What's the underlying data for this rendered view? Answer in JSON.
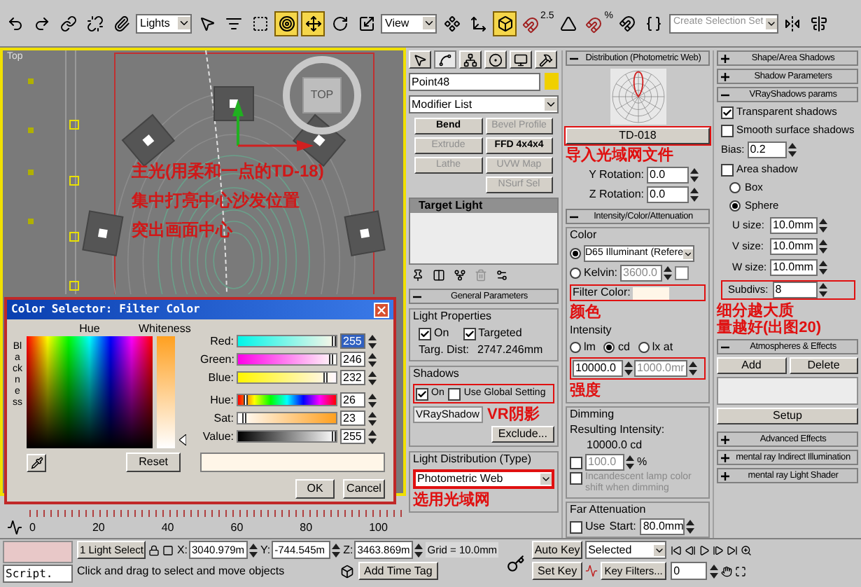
{
  "toolbar": {
    "items": [
      {
        "kind": "icon",
        "selected": false
      },
      {
        "kind": "icon",
        "selected": false
      },
      {
        "kind": "icon",
        "selected": false
      },
      {
        "kind": "icon",
        "selected": false
      },
      {
        "kind": "icon",
        "selected": false
      },
      {
        "kind": "dropdown",
        "value": "Lights"
      },
      {
        "kind": "icon",
        "selected": false
      },
      {
        "kind": "icon",
        "selected": false
      },
      {
        "kind": "icon",
        "selected": false
      },
      {
        "kind": "icon",
        "selected": true
      },
      {
        "kind": "icon",
        "selected": true
      },
      {
        "kind": "icon",
        "selected": false
      },
      {
        "kind": "icon",
        "selected": false
      },
      {
        "kind": "dropdown",
        "value": "View"
      },
      {
        "kind": "icon",
        "selected": false
      },
      {
        "kind": "icon",
        "selected": false
      },
      {
        "kind": "icon",
        "selected": true
      },
      {
        "kind": "snap",
        "label": "2.5",
        "selected": false
      },
      {
        "kind": "icon",
        "selected": false
      },
      {
        "kind": "snap",
        "label": "%",
        "selected": false
      },
      {
        "kind": "icon",
        "selected": false
      },
      {
        "kind": "icon",
        "selected": false
      },
      {
        "kind": "selection_set",
        "placeholder": "Create Selection Set"
      },
      {
        "kind": "icon",
        "selected": false
      },
      {
        "kind": "icon",
        "selected": false
      }
    ]
  },
  "viewport": {
    "label": "Top",
    "view_cube": "TOP",
    "annotation": [
      "主光(用柔和一点的TD-18)",
      "集中打亮中心沙发位置",
      "突出画面中心"
    ]
  },
  "color_selector": {
    "title": "Color Selector: Filter Color",
    "hue_label": "Hue",
    "whiteness_label": "Whiteness",
    "blackness_label": "Blackness",
    "channels": [
      {
        "name": "Red:",
        "value": "255",
        "level": 1.0,
        "selected": true
      },
      {
        "name": "Green:",
        "value": "246",
        "level": 0.965,
        "selected": false
      },
      {
        "name": "Blue:",
        "value": "232",
        "level": 0.91,
        "selected": false
      },
      {
        "name": "Hue:",
        "value": "26",
        "level": 0.1,
        "selected": false
      },
      {
        "name": "Sat:",
        "value": "23",
        "level": 0.09,
        "selected": false
      },
      {
        "name": "Value:",
        "value": "255",
        "level": 1.0,
        "selected": false
      }
    ],
    "reset": "Reset",
    "ok": "OK",
    "cancel": "Cancel"
  },
  "timeline": {
    "ticks": [
      "0",
      "20",
      "40",
      "60",
      "80",
      "100"
    ]
  },
  "command_tabs": [
    {
      "selected": false
    },
    {
      "selected": true
    },
    {
      "selected": false
    },
    {
      "selected": false
    },
    {
      "selected": false
    },
    {
      "selected": false
    }
  ],
  "modify": {
    "object_name": "Point48",
    "modifier_list": "Modifier List",
    "modifier_buttons": [
      {
        "label": "Bend",
        "disabled": false
      },
      {
        "label": "Bevel Profile",
        "disabled": true
      },
      {
        "label": "Extrude",
        "disabled": true
      },
      {
        "label": "FFD 4x4x4",
        "disabled": false
      },
      {
        "label": "Lathe",
        "disabled": true
      },
      {
        "label": "UVW Map",
        "disabled": true
      },
      {
        "label": "NSurf Sel",
        "disabled": true
      }
    ],
    "stack_item": "Target Light"
  },
  "general": {
    "title": "General Parameters",
    "expanded": true,
    "light_properties": "Light Properties",
    "on": {
      "label": "On",
      "checked": true
    },
    "targeted": {
      "label": "Targeted",
      "checked": true
    },
    "targ_dist_label": "Targ. Dist:",
    "targ_dist": "2747.246mm",
    "shadows": "Shadows",
    "shadow_on": {
      "label": "On",
      "checked": true
    },
    "use_global": {
      "label": "Use Global Setting",
      "checked": false
    },
    "shadow_type": "VRayShadow",
    "shadow_note": "VR阴影",
    "exclude": "Exclude...",
    "distribution_label": "Light Distribution (Type)",
    "distribution": "Photometric Web",
    "distribution_note": "选用光域网"
  },
  "distribution": {
    "title": "Distribution (Photometric Web)",
    "expanded": true,
    "file": "TD-018",
    "note": "导入光域网文件",
    "rotations": [
      {
        "label": "Y Rotation:",
        "value": "0.0"
      },
      {
        "label": "Z Rotation:",
        "value": "0.0"
      }
    ]
  },
  "intensity": {
    "title": "Intensity/Color/Attenuation",
    "expanded": true,
    "color_label": "Color",
    "d65": {
      "label": "D65 Illuminant (Refere",
      "selected": true
    },
    "kelvin": {
      "label": "Kelvin:",
      "value": "3600.0",
      "selected": false,
      "disabled": true
    },
    "filter_label": "Filter Color:",
    "filter_note": "颜色",
    "intensity_label": "Intensity",
    "units": [
      {
        "label": "lm",
        "selected": false
      },
      {
        "label": "cd",
        "selected": true
      },
      {
        "label": "lx at",
        "selected": false
      }
    ],
    "value": "10000.0",
    "distance": {
      "value": "1000.0mr",
      "disabled": true
    },
    "intensity_note": "强度",
    "dimming_label": "Dimming",
    "resulting_label": "Resulting Intensity:",
    "resulting": "10000.0 cd",
    "percent": {
      "checked": false,
      "value": "100.0",
      "unit": "%",
      "disabled": true
    },
    "incandescent": {
      "label": "Incandescent lamp color shift when dimming",
      "checked": false,
      "disabled": true
    },
    "far_label": "Far Attenuation",
    "far_use": {
      "label": "Use",
      "checked": false
    },
    "start_label": "Start:",
    "start": "80.0mm"
  },
  "shadow_rollouts": [
    {
      "title": "Shape/Area Shadows",
      "expanded": false
    },
    {
      "title": "Shadow Parameters",
      "expanded": false
    },
    {
      "title": "VRayShadows params",
      "expanded": true
    }
  ],
  "vray": {
    "transparent": {
      "label": "Transparent shadows",
      "checked": true
    },
    "smooth": {
      "label": "Smooth surface shadows",
      "checked": false
    },
    "bias_label": "Bias:",
    "bias": "0.2",
    "area": {
      "label": "Area shadow",
      "checked": false
    },
    "shapes": [
      {
        "label": "Box",
        "selected": false
      },
      {
        "label": "Sphere",
        "selected": true
      }
    ],
    "sizes": [
      {
        "label": "U size:",
        "value": "10.0mm"
      },
      {
        "label": "V size:",
        "value": "10.0mm"
      },
      {
        "label": "W size:",
        "value": "10.0mm"
      }
    ],
    "subdivs_label": "Subdivs:",
    "subdivs": "8",
    "note": [
      "细分越大质",
      "量越好(出图20)"
    ]
  },
  "atmospheres": {
    "title": "Atmospheres & Effects",
    "expanded": true,
    "add": "Add",
    "delete": "Delete",
    "setup": "Setup"
  },
  "more_rollouts": [
    {
      "title": "Advanced Effects",
      "expanded": false
    },
    {
      "title": "mental ray Indirect Illumination",
      "expanded": false
    },
    {
      "title": "mental ray Light Shader",
      "expanded": false
    }
  ],
  "status": {
    "script": "Script.",
    "selection": "1 Light Select",
    "coords": [
      {
        "axis": "X:",
        "value": "3040.979m"
      },
      {
        "axis": "Y:",
        "value": "-744.545m"
      },
      {
        "axis": "Z:",
        "value": "3463.869m"
      }
    ],
    "grid": "Grid = 10.0mm",
    "prompt": "Click and drag to select and move objects",
    "add_time_tag": "Add Time Tag",
    "auto_key": "Auto Key",
    "set_key": "Set Key",
    "key_mode": "Selected",
    "key_filters": "Key Filters...",
    "frame": "0"
  }
}
